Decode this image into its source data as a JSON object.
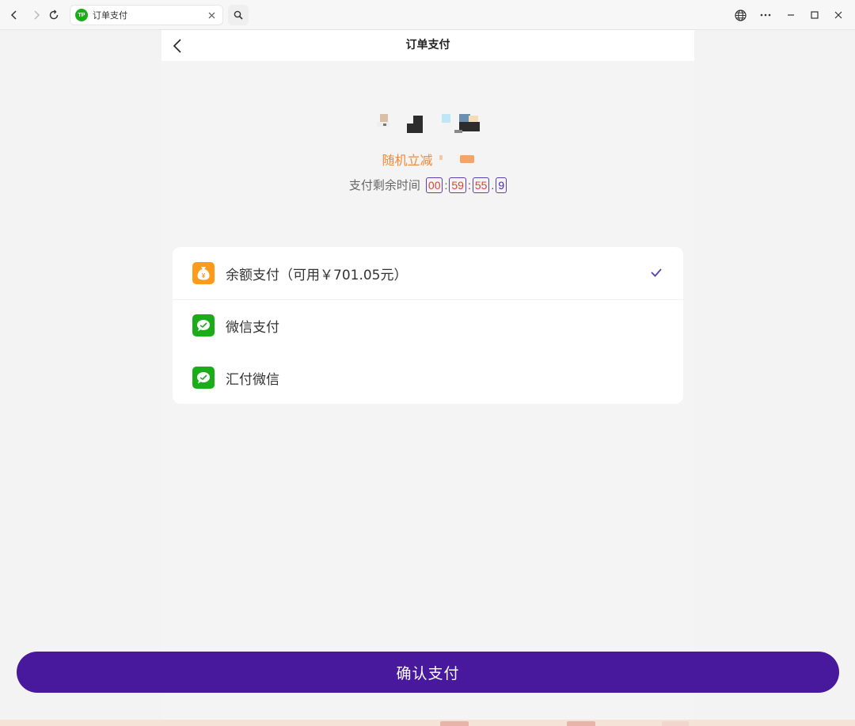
{
  "browser": {
    "tab_title": "订单支付",
    "favicon_text": "TP",
    "icons": {
      "back": "chevron-left-icon",
      "forward": "chevron-right-icon",
      "reload": "refresh-icon",
      "search": "search-icon",
      "globe": "globe-icon",
      "more": "more-icon",
      "minimize": "minimize-icon",
      "maximize": "maximize-icon",
      "close": "close-icon"
    }
  },
  "page": {
    "title": "订单支付",
    "discount_label": "随机立减",
    "timer": {
      "label": "支付剩余时间",
      "hours": "00",
      "minutes": "59",
      "seconds": "55",
      "tenths": "9",
      "sep_colon": ":",
      "sep_dot": "."
    }
  },
  "payment_methods": [
    {
      "label": "余额支付（可用￥701.05元）",
      "icon": "wallet-icon",
      "selected": true
    },
    {
      "label": "微信支付",
      "icon": "wechat-icon",
      "selected": false
    },
    {
      "label": "汇付微信",
      "icon": "wechat-icon",
      "selected": false
    }
  ],
  "confirm_button": {
    "label": "确认支付"
  },
  "colors": {
    "accent": "#48199c",
    "discount": "#f08a3c",
    "timer_digits": "#d0473e",
    "wallet_icon": "#ff9a1a",
    "wechat_icon": "#1aad19"
  }
}
